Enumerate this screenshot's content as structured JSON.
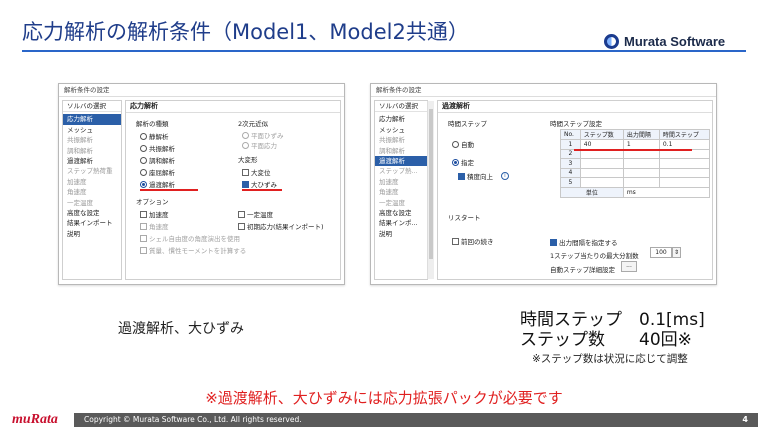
{
  "slide": {
    "title": "応力解析の解析条件（Model1、Model2共通）",
    "brand": "Murata Software"
  },
  "left_dialog": {
    "window_title": "解析条件の設定",
    "nav": [
      "ソルバの選択",
      "応力解析",
      "メッシュ",
      "共振解析",
      "調和解析",
      "過渡解析",
      "ステップ熱荷重",
      "加速度",
      "角速度",
      "一定温度",
      "高度な設定",
      "結果インポート",
      "説明"
    ],
    "panel_title": "応力解析",
    "analysis_type_label": "解析の種類",
    "analysis_types": [
      "静解析",
      "共振解析",
      "調和解析",
      "座屈解析",
      "過渡解析"
    ],
    "analysis_selected": "過渡解析",
    "twod_label": "2次元近似",
    "twod_options": [
      "平面ひずみ",
      "平面応力"
    ],
    "large_def_label": "大変形",
    "large_def_options": [
      "大変位",
      "大ひずみ"
    ],
    "large_def_selected": "大ひずみ",
    "options_label": "オプション",
    "options": [
      "加速度",
      "角速度",
      "シェル自由度の角度演出を使用",
      "質量、慣性モーメントを計算する"
    ],
    "options_right": [
      "一定温度",
      "初期応力(結果インポート)"
    ]
  },
  "right_dialog": {
    "window_title": "解析条件の設定",
    "nav": [
      "ソルバの選択",
      "応力解析",
      "メッシュ",
      "共振解析",
      "調和解析",
      "過渡解析",
      "ステップ熱...",
      "加速度",
      "角速度",
      "一定温度",
      "高度な設定",
      "結果インポ...",
      "説明"
    ],
    "panel_title": "過渡解析",
    "time_step_label": "時間ステップ",
    "time_step_options": [
      "自動",
      "指定"
    ],
    "time_step_selected": "指定",
    "accuracy_label": "積度向上",
    "info_icon": "i",
    "restart_label": "リスタート",
    "continue_label": "前回の続き",
    "table_title": "時間ステップ設定",
    "table_headers": [
      "No.",
      "ステップ数",
      "出力間隔",
      "時間ステップ"
    ],
    "table_rows": [
      {
        "no": "1",
        "steps": "40",
        "interval": "1",
        "time": "0.1"
      },
      {
        "no": "2",
        "steps": "",
        "interval": "",
        "time": ""
      },
      {
        "no": "3",
        "steps": "",
        "interval": "",
        "time": ""
      },
      {
        "no": "4",
        "steps": "",
        "interval": "",
        "time": ""
      },
      {
        "no": "5",
        "steps": "",
        "interval": "",
        "time": ""
      }
    ],
    "unit_label": "単位",
    "unit_value": "ms",
    "output_interval_label": "出力間隔を指定する",
    "max_iter_label": "1ステップ当たりの最大分割数",
    "max_iter_value": "100",
    "auto_detail_label": "自動ステップ詳細設定",
    "dots_label": "..."
  },
  "captions": {
    "left": "過渡解析、大ひずみ",
    "time_step": "時間ステップ　0.1[ms]",
    "step_count": "ステップ数　　40回※",
    "footnote": "※ステップ数は状況に応じて調整",
    "warning": "※過渡解析、大ひずみには応力拡張パックが必要です"
  },
  "footer": {
    "logo": "muRata",
    "copyright": "Copyright © Murata Software Co., Ltd. All rights reserved.",
    "page": "4"
  }
}
